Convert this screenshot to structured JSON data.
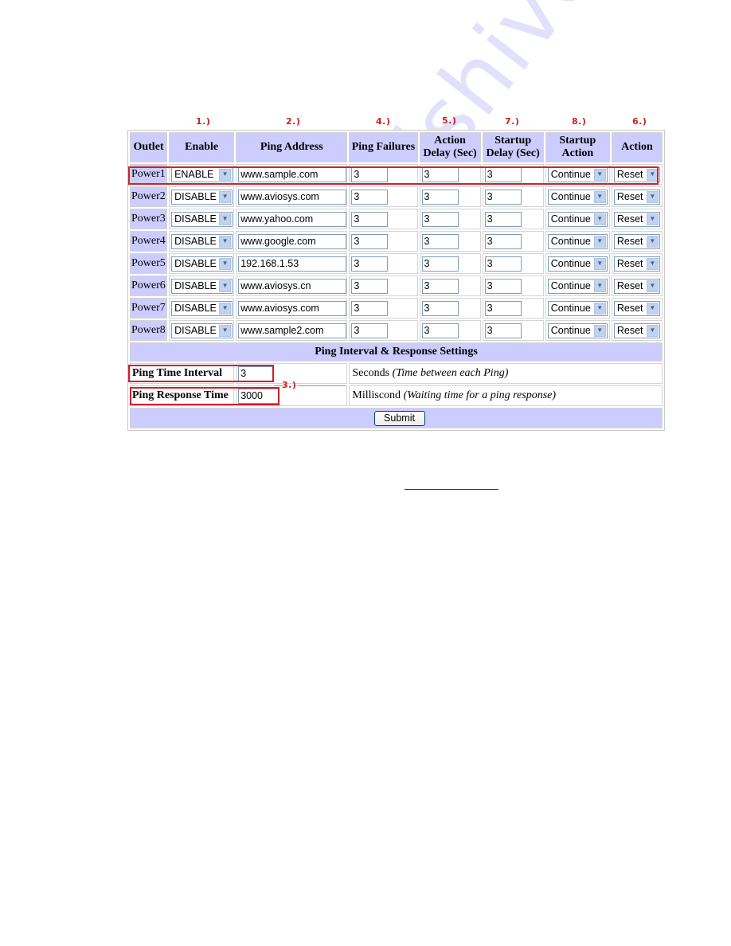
{
  "annotations": {
    "enable": "1.)",
    "ping_address": "2.)",
    "ping_interval_response": "3.)",
    "ping_failures": "4.)",
    "action_delay": "5.)",
    "action": "6.)",
    "startup_delay": "7.)",
    "startup_action": "8.)"
  },
  "table": {
    "headers": {
      "outlet": "Outlet",
      "enable": "Enable",
      "ping_address": "Ping Address",
      "ping_failures": "Ping Failures",
      "action_delay_1": "Action",
      "action_delay_2": "Delay (Sec)",
      "startup_delay_1": "Startup",
      "startup_delay_2": "Delay (Sec)",
      "startup_action_1": "Startup",
      "startup_action_2": "Action",
      "action": "Action"
    },
    "rows": [
      {
        "outlet": "Power1",
        "enable": "ENABLE",
        "address": "www.sample.com",
        "failures": "3",
        "action_delay": "3",
        "startup_delay": "3",
        "startup_action": "Continue",
        "action": "Reset"
      },
      {
        "outlet": "Power2",
        "enable": "DISABLE",
        "address": "www.aviosys.com",
        "failures": "3",
        "action_delay": "3",
        "startup_delay": "3",
        "startup_action": "Continue",
        "action": "Reset"
      },
      {
        "outlet": "Power3",
        "enable": "DISABLE",
        "address": "www.yahoo.com",
        "failures": "3",
        "action_delay": "3",
        "startup_delay": "3",
        "startup_action": "Continue",
        "action": "Reset"
      },
      {
        "outlet": "Power4",
        "enable": "DISABLE",
        "address": "www.google.com",
        "failures": "3",
        "action_delay": "3",
        "startup_delay": "3",
        "startup_action": "Continue",
        "action": "Reset"
      },
      {
        "outlet": "Power5",
        "enable": "DISABLE",
        "address": "192.168.1.53",
        "failures": "3",
        "action_delay": "3",
        "startup_delay": "3",
        "startup_action": "Continue",
        "action": "Reset"
      },
      {
        "outlet": "Power6",
        "enable": "DISABLE",
        "address": "www.aviosys.cn",
        "failures": "3",
        "action_delay": "3",
        "startup_delay": "3",
        "startup_action": "Continue",
        "action": "Reset"
      },
      {
        "outlet": "Power7",
        "enable": "DISABLE",
        "address": "www.aviosys.com",
        "failures": "3",
        "action_delay": "3",
        "startup_delay": "3",
        "startup_action": "Continue",
        "action": "Reset"
      },
      {
        "outlet": "Power8",
        "enable": "DISABLE",
        "address": "www.sample2.com",
        "failures": "3",
        "action_delay": "3",
        "startup_delay": "3",
        "startup_action": "Continue",
        "action": "Reset"
      }
    ]
  },
  "settings": {
    "section_title": "Ping Interval & Response Settings",
    "interval_label": "Ping Time Interval",
    "interval_value": "3",
    "interval_unit": "Seconds",
    "interval_hint": "(Time between each Ping)",
    "response_label": "Ping Response Time",
    "response_value": "3000",
    "response_unit": "Milliscond",
    "response_hint": "(Waiting time for a ping response)",
    "submit_label": "Submit"
  },
  "link": {
    "text": ""
  },
  "watermark": "manualshive.com",
  "icons": {
    "dropdown_arrow": "▼"
  },
  "colors": {
    "header_bg": "#ccccff",
    "annotation_red": "#d21f2a"
  }
}
